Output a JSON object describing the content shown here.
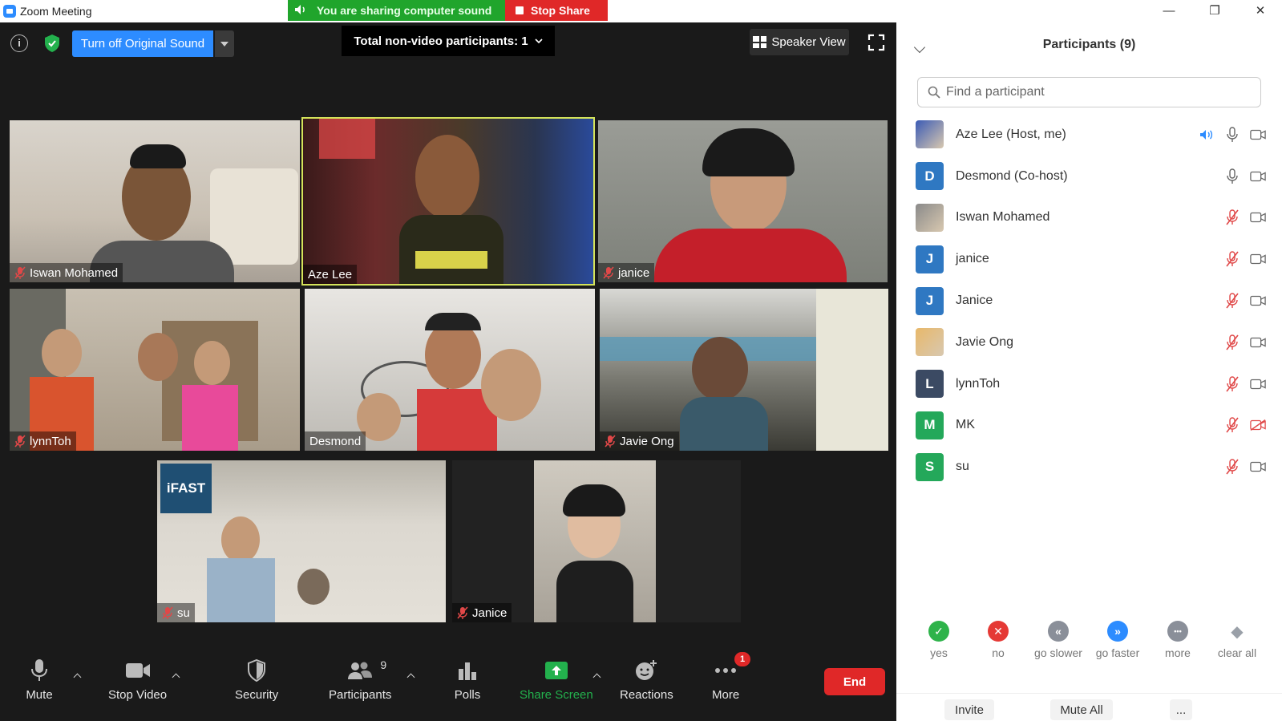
{
  "window": {
    "title": "Zoom Meeting",
    "sharing_text": "You are sharing computer sound",
    "stop_share_label": "Stop Share",
    "minimize": "—",
    "restore": "❐",
    "close": "✕"
  },
  "top_controls": {
    "original_sound_label": "Turn off Original Sound",
    "non_video_label": "Total non-video participants: 1",
    "speaker_view_label": "Speaker View"
  },
  "tiles": [
    {
      "name": "Iswan Mohamed",
      "muted": true
    },
    {
      "name": "Aze Lee",
      "muted": false,
      "active": true
    },
    {
      "name": "janice",
      "muted": true
    },
    {
      "name": "lynnToh",
      "muted": true
    },
    {
      "name": "Desmond",
      "muted": false
    },
    {
      "name": "Javie Ong",
      "muted": true
    },
    {
      "name": "su",
      "muted": true,
      "overlay_text": "iFAST"
    },
    {
      "name": "Janice",
      "muted": true
    },
    {
      "name": "",
      "muted": false
    }
  ],
  "toolbar": {
    "mute": "Mute",
    "stop_video": "Stop Video",
    "security": "Security",
    "participants": "Participants",
    "participants_count": "9",
    "polls": "Polls",
    "share_screen": "Share Screen",
    "reactions": "Reactions",
    "more": "More",
    "more_badge": "1",
    "end": "End"
  },
  "panel": {
    "title": "Participants (9)",
    "search_placeholder": "Find a participant",
    "participants": [
      {
        "name": "Aze Lee (Host, me)",
        "initial": "",
        "color": "#3b5bb5",
        "mic": "speaking",
        "video": "on"
      },
      {
        "name": "Desmond (Co-host)",
        "initial": "D",
        "color": "#2f78c2",
        "mic": "on",
        "video": "on"
      },
      {
        "name": "Iswan Mohamed",
        "initial": "",
        "color": "#8a8a8a",
        "mic": "muted",
        "video": "on"
      },
      {
        "name": "janice",
        "initial": "J",
        "color": "#2f78c2",
        "mic": "muted",
        "video": "on"
      },
      {
        "name": "Janice",
        "initial": "J",
        "color": "#2f78c2",
        "mic": "muted",
        "video": "on"
      },
      {
        "name": "Javie Ong",
        "initial": "",
        "color": "#e8b86a",
        "mic": "muted",
        "video": "on"
      },
      {
        "name": "lynnToh",
        "initial": "L",
        "color": "#3b4a63",
        "mic": "muted",
        "video": "on"
      },
      {
        "name": "MK",
        "initial": "M",
        "color": "#24a85a",
        "mic": "muted",
        "video": "off"
      },
      {
        "name": "su",
        "initial": "S",
        "color": "#24a85a",
        "mic": "muted",
        "video": "on"
      }
    ],
    "reactions": [
      {
        "label": "yes",
        "color": "#2eb34a",
        "glyph": "✓"
      },
      {
        "label": "no",
        "color": "#e53935",
        "glyph": "✕"
      },
      {
        "label": "go slower",
        "color": "#8a8f99",
        "glyph": "«"
      },
      {
        "label": "go faster",
        "color": "#2d8cff",
        "glyph": "»"
      },
      {
        "label": "more",
        "color": "#8a8f99",
        "glyph": "•••"
      },
      {
        "label": "clear all",
        "color": "#9aa0a8",
        "glyph": "◆"
      }
    ],
    "invite": "Invite",
    "mute_all": "Mute All",
    "more_btn": "..."
  },
  "colors": {
    "accent_blue": "#2d8cff",
    "share_green": "#20a52c",
    "stop_red": "#e02828",
    "active_border": "#d4e35a",
    "mute_red": "#e04848"
  }
}
